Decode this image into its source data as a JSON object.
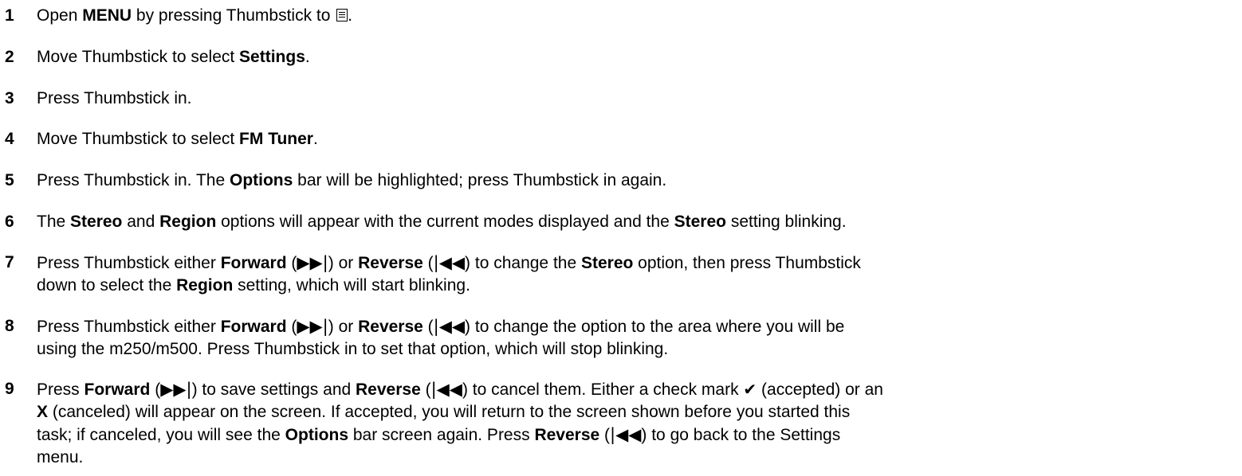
{
  "steps": [
    {
      "num": "1",
      "runs": [
        {
          "t": "Open "
        },
        {
          "t": "MENU",
          "b": true
        },
        {
          "t": " by pressing Thumbstick to "
        },
        {
          "icon": "menu-icon"
        },
        {
          "t": "."
        }
      ]
    },
    {
      "num": "2",
      "runs": [
        {
          "t": "Move Thumbstick to select "
        },
        {
          "t": "Settings",
          "b": true
        },
        {
          "t": "."
        }
      ]
    },
    {
      "num": "3",
      "runs": [
        {
          "t": "Press Thumbstick in."
        }
      ]
    },
    {
      "num": "4",
      "runs": [
        {
          "t": "Move Thumbstick to select "
        },
        {
          "t": "FM Tuner",
          "b": true
        },
        {
          "t": "."
        }
      ]
    },
    {
      "num": "5",
      "runs": [
        {
          "t": "Press Thumbstick in. The "
        },
        {
          "t": "Options",
          "b": true
        },
        {
          "t": " bar will be highlighted; press Thumbstick in again."
        }
      ]
    },
    {
      "num": "6",
      "runs": [
        {
          "t": "The "
        },
        {
          "t": "Stereo",
          "b": true
        },
        {
          "t": " and "
        },
        {
          "t": "Region",
          "b": true
        },
        {
          "t": " options will appear with the current modes displayed and the "
        },
        {
          "t": "Stereo",
          "b": true
        },
        {
          "t": " setting blinking."
        }
      ]
    },
    {
      "num": "7",
      "runs": [
        {
          "t": "Press Thumbstick either "
        },
        {
          "t": "Forward",
          "b": true
        },
        {
          "t": " ("
        },
        {
          "t": "▶▶|",
          "g": true
        },
        {
          "t": ") or "
        },
        {
          "t": "Reverse",
          "b": true
        },
        {
          "t": " ("
        },
        {
          "t": "|◀◀",
          "g": true
        },
        {
          "t": ") to change the "
        },
        {
          "t": "Stereo",
          "b": true
        },
        {
          "t": " option, then press Thumbstick"
        },
        {
          "br": true
        },
        {
          "t": "down to select the "
        },
        {
          "t": "Region",
          "b": true
        },
        {
          "t": " setting, which will start blinking."
        }
      ]
    },
    {
      "num": "8",
      "runs": [
        {
          "t": "Press Thumbstick either "
        },
        {
          "t": "Forward",
          "b": true
        },
        {
          "t": " ("
        },
        {
          "t": "▶▶|",
          "g": true
        },
        {
          "t": ") or "
        },
        {
          "t": "Reverse",
          "b": true
        },
        {
          "t": " ("
        },
        {
          "t": "|◀◀",
          "g": true
        },
        {
          "t": ") to change the option to the area where you will be"
        },
        {
          "br": true
        },
        {
          "t": "using the m250/m500. Press Thumbstick in to set that option, which will stop blinking."
        }
      ]
    },
    {
      "num": "9",
      "runs": [
        {
          "t": "Press "
        },
        {
          "t": "Forward",
          "b": true
        },
        {
          "t": " ("
        },
        {
          "t": "▶▶|",
          "g": true
        },
        {
          "t": ") to save settings and "
        },
        {
          "t": "Reverse",
          "b": true
        },
        {
          "t": " ("
        },
        {
          "t": "|◀◀",
          "g": true
        },
        {
          "t": ") to cancel them. Either a check mark "
        },
        {
          "t": "✔",
          "check": true
        },
        {
          "t": " (accepted) or an"
        },
        {
          "br": true
        },
        {
          "t": "X",
          "b": true
        },
        {
          "t": " (canceled) will appear on the screen. If accepted, you will return to the screen shown before you started this"
        },
        {
          "br": true
        },
        {
          "t": "task; if canceled, you will see the "
        },
        {
          "t": "Options",
          "b": true
        },
        {
          "t": " bar screen again. Press "
        },
        {
          "t": "Reverse",
          "b": true
        },
        {
          "t": " ("
        },
        {
          "t": "|◀◀",
          "g": true
        },
        {
          "t": ") to go back to the Settings"
        },
        {
          "br": true
        },
        {
          "t": "menu."
        }
      ]
    }
  ]
}
